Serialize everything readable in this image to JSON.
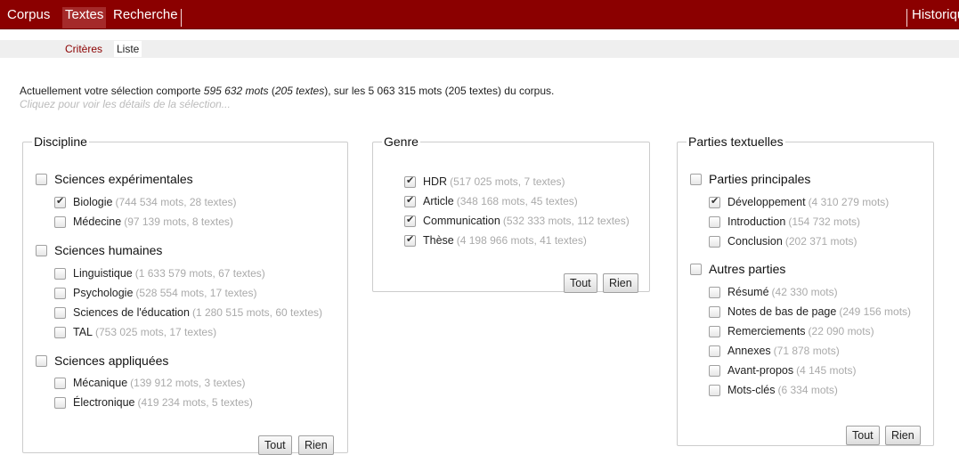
{
  "nav": {
    "tabs": [
      {
        "label": "Corpus"
      },
      {
        "label": "Textes"
      },
      {
        "label": "Recherche"
      }
    ],
    "right_tab": "Historique"
  },
  "subnav": {
    "tabs": [
      {
        "label": "Critères"
      },
      {
        "label": "Liste"
      }
    ]
  },
  "summary": {
    "prefix": "Actuellement votre sélection comporte ",
    "selected_words": "595 632 mots",
    "mid1": " (",
    "selected_texts": "205 textes",
    "mid2": "), sur les 5 063 315 mots (205 textes) du corpus.",
    "hint": "Cliquez pour voir les détails de la sélection..."
  },
  "discipline": {
    "legend": "Discipline",
    "groups": [
      {
        "label": "Sciences expérimentales",
        "checked": false,
        "items": [
          {
            "label": "Biologie",
            "meta": "(744 534 mots, 28 textes)",
            "checked": true
          },
          {
            "label": "Médecine",
            "meta": "(97 139 mots, 8 textes)",
            "checked": false
          }
        ]
      },
      {
        "label": "Sciences humaines",
        "checked": false,
        "items": [
          {
            "label": "Linguistique",
            "meta": "(1 633 579 mots, 67 textes)",
            "checked": false
          },
          {
            "label": "Psychologie",
            "meta": "(528 554 mots, 17 textes)",
            "checked": false
          },
          {
            "label": "Sciences de l'éducation",
            "meta": "(1 280 515 mots, 60 textes)",
            "checked": false
          },
          {
            "label": "TAL",
            "meta": "(753 025 mots, 17 textes)",
            "checked": false
          }
        ]
      },
      {
        "label": "Sciences appliquées",
        "checked": false,
        "items": [
          {
            "label": "Mécanique",
            "meta": "(139 912 mots, 3 textes)",
            "checked": false
          },
          {
            "label": "Électronique",
            "meta": "(419 234 mots, 5 textes)",
            "checked": false
          }
        ]
      }
    ],
    "btn_all": "Tout",
    "btn_none": "Rien"
  },
  "genre": {
    "legend": "Genre",
    "items": [
      {
        "label": "HDR",
        "meta": "(517 025 mots, 7 textes)",
        "checked": true
      },
      {
        "label": "Article",
        "meta": "(348 168 mots, 45 textes)",
        "checked": true
      },
      {
        "label": "Communication",
        "meta": "(532 333 mots, 112 textes)",
        "checked": true
      },
      {
        "label": "Thèse",
        "meta": "(4 198 966 mots, 41 textes)",
        "checked": true
      }
    ],
    "btn_all": "Tout",
    "btn_none": "Rien"
  },
  "parties": {
    "legend": "Parties textuelles",
    "groups": [
      {
        "label": "Parties principales",
        "checked": false,
        "items": [
          {
            "label": "Développement",
            "meta": "(4 310 279 mots)",
            "checked": true
          },
          {
            "label": "Introduction",
            "meta": "(154 732 mots)",
            "checked": false
          },
          {
            "label": "Conclusion",
            "meta": "(202 371 mots)",
            "checked": false
          }
        ]
      },
      {
        "label": "Autres parties",
        "checked": false,
        "items": [
          {
            "label": "Résumé",
            "meta": "(42 330 mots)",
            "checked": false
          },
          {
            "label": "Notes de bas de page",
            "meta": "(249 156 mots)",
            "checked": false
          },
          {
            "label": "Remerciements",
            "meta": "(22 090 mots)",
            "checked": false
          },
          {
            "label": "Annexes",
            "meta": "(71 878 mots)",
            "checked": false
          },
          {
            "label": "Avant-propos",
            "meta": "(4 145 mots)",
            "checked": false
          },
          {
            "label": "Mots-clés",
            "meta": "(6 334 mots)",
            "checked": false
          }
        ]
      }
    ],
    "btn_all": "Tout",
    "btn_none": "Rien"
  },
  "colors": {
    "nav_bg": "#8b0000",
    "meta_grey": "#aaaaaa"
  }
}
